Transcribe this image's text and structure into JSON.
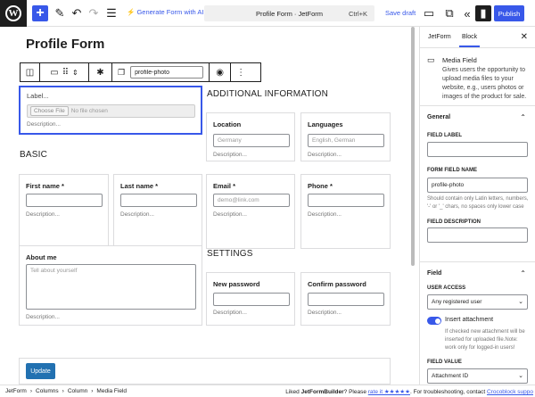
{
  "header": {
    "title": "Profile Form · JetForm",
    "shortcut": "Ctrl+K",
    "generate_ai": "Generate Form with AI",
    "save_draft": "Save draft",
    "publish": "Publish"
  },
  "canvas": {
    "page_title": "Profile Form",
    "toolbar_field_name": "profile-photo",
    "media_field": {
      "label": "Label...",
      "choose_file": "Choose File",
      "no_file": "No file chosen",
      "description": "Description..."
    },
    "sections": {
      "basic": "BASIC",
      "additional": "ADDITIONAL INFORMATION",
      "settings": "SETTINGS"
    },
    "fields": {
      "location": {
        "label": "Location",
        "placeholder": "Germany",
        "description": "Description..."
      },
      "languages": {
        "label": "Languages",
        "placeholder": "English, German",
        "description": "Description..."
      },
      "first_name": {
        "label": "First name *",
        "placeholder": "",
        "description": "Description..."
      },
      "last_name": {
        "label": "Last name *",
        "placeholder": "",
        "description": "Description..."
      },
      "email": {
        "label": "Email *",
        "placeholder": "demo@link.com",
        "description": "Description..."
      },
      "phone": {
        "label": "Phone *",
        "placeholder": "",
        "description": "Description..."
      },
      "about_me": {
        "label": "About me",
        "placeholder": "Tell about yourself",
        "description": "Description..."
      },
      "new_password": {
        "label": "New password",
        "placeholder": "",
        "description": "Description..."
      },
      "confirm_password": {
        "label": "Confirm password",
        "placeholder": "",
        "description": "Description..."
      }
    },
    "update_button": "Update"
  },
  "sidebar": {
    "tabs": [
      "JetForm",
      "Block"
    ],
    "active_tab": "Block",
    "block_name": "Media Field",
    "block_description": "Gives users the opportunity to upload media files to your website, e.g., users photos or images of the product for sale.",
    "general": {
      "title": "General",
      "field_label": "FIELD LABEL",
      "field_label_value": "",
      "form_field_name": "FORM FIELD NAME",
      "form_field_name_value": "profile-photo",
      "name_help": "Should contain only Latin letters, numbers, '-' or '_' chars, no spaces only lower case",
      "field_description": "FIELD DESCRIPTION",
      "field_description_value": ""
    },
    "field": {
      "title": "Field",
      "user_access": "USER ACCESS",
      "user_access_value": "Any registered user",
      "insert_attachment": "Insert attachment",
      "insert_help": "If checked new attachment will be inserted for uploaded file.Note: work only for logged-in users!",
      "field_value": "FIELD VALUE",
      "field_value_value": "Attachment ID"
    }
  },
  "footer": {
    "breadcrumbs": [
      "JetForm",
      "Columns",
      "Column",
      "Media Field"
    ],
    "liked_text": "Liked",
    "product": "JetFormBuilder",
    "please": "? Please",
    "rate_link": "rate it ★★★★★",
    "troubleshoot": ". For troubleshooting, contact",
    "support_link": "Crocoblock suppo"
  },
  "colors": {
    "accent": "#3858e9",
    "update_button": "#2271b1"
  }
}
